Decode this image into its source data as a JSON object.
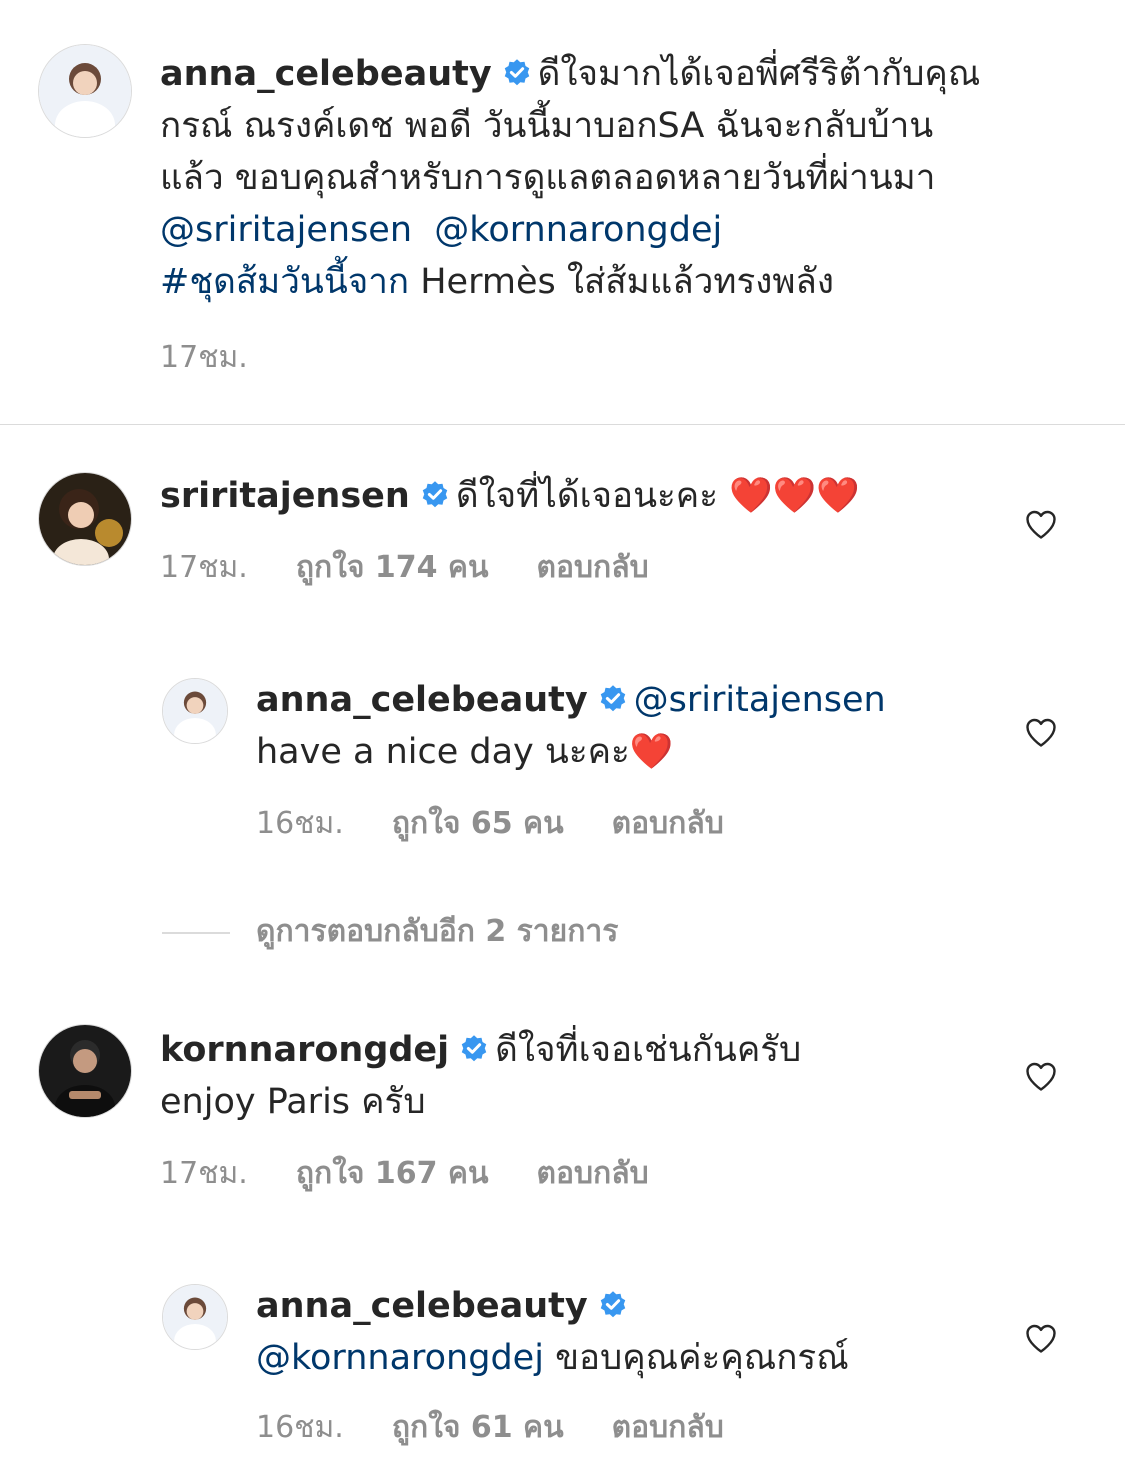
{
  "caption": {
    "username": "anna_celebeauty",
    "text_line1": "ดีใจมากได้เจอพี่ศรีริต้ากับคุณ",
    "text_line2": "กรณ์ ณรงค์เดช พอดี วันนี้มาบอกSA ฉันจะกลับบ้าน",
    "text_line3": "แล้ว ขอบคุณสำหรับการดูแลตลอดหลายวันที่ผ่านมา",
    "mention1": "@sriritajensen",
    "mention2": "@kornnarongdej",
    "hashtag": "#ชุดส้มวันนี้จาก",
    "text_line5": " Hermès ใส่ส้มแล้วทรงพลัง",
    "time": "17ชม."
  },
  "comments": [
    {
      "username": "sriritajensen",
      "text": "ดีใจที่ได้เจอนะคะ",
      "emoji": "❤️❤️❤️",
      "time": "17ชม.",
      "likes": "ถูกใจ 174 คน",
      "reply": "ตอบกลับ"
    },
    {
      "username": "anna_celebeauty",
      "mention": "@sriritajensen",
      "text": "have a nice day นะคะ",
      "emoji": "❤️",
      "time": "16ชม.",
      "likes": "ถูกใจ 65 คน",
      "reply": "ตอบกลับ"
    },
    {
      "username": "kornnarongdej",
      "text": "ดีใจที่เจอเช่นกันครับ",
      "text_line2": "enjoy Paris ครับ",
      "time": "17ชม.",
      "likes": "ถูกใจ 167 คน",
      "reply": "ตอบกลับ"
    },
    {
      "username": "anna_celebeauty",
      "mention": "@kornnarongdej",
      "text": " ขอบคุณค่ะคุณกรณ์",
      "time": "16ชม.",
      "likes": "ถูกใจ 61 คน",
      "reply": "ตอบกลับ"
    }
  ],
  "view_more_replies": "ดูการตอบกลับอีก 2 รายการ",
  "icons": {
    "verified": "verified-badge-icon",
    "like": "heart-outline-icon"
  },
  "colors": {
    "text": "#262626",
    "secondary": "#8e8e8e",
    "link": "#00376b",
    "verified": "#3897f0",
    "heart_emoji": "#e0241b"
  }
}
